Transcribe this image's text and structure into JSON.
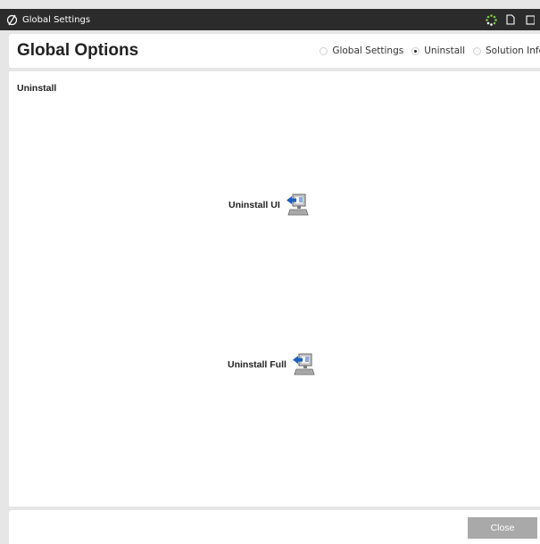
{
  "window": {
    "title": "Global Settings",
    "app_icon": "slashed-circle-icon",
    "controls": [
      "loading-spinner-icon",
      "document-icon",
      "window-icon"
    ]
  },
  "header": {
    "title": "Global Options",
    "radios": [
      {
        "label": "Global Settings",
        "checked": false
      },
      {
        "label": "Uninstall",
        "checked": true
      },
      {
        "label": "Solution Info",
        "checked": false
      }
    ]
  },
  "main": {
    "section_title": "Uninstall",
    "actions": [
      {
        "label": "Uninstall UI",
        "icon": "computer-uninstall-icon"
      },
      {
        "label": "Uninstall Full",
        "icon": "computer-uninstall-icon"
      }
    ]
  },
  "footer": {
    "close_label": "Close"
  },
  "colors": {
    "titlebar": "#2b2b2b",
    "background": "#e6e6e6",
    "button": "#a9a9a9",
    "spinner": "#7ac943",
    "arrow": "#1f5fbf"
  }
}
